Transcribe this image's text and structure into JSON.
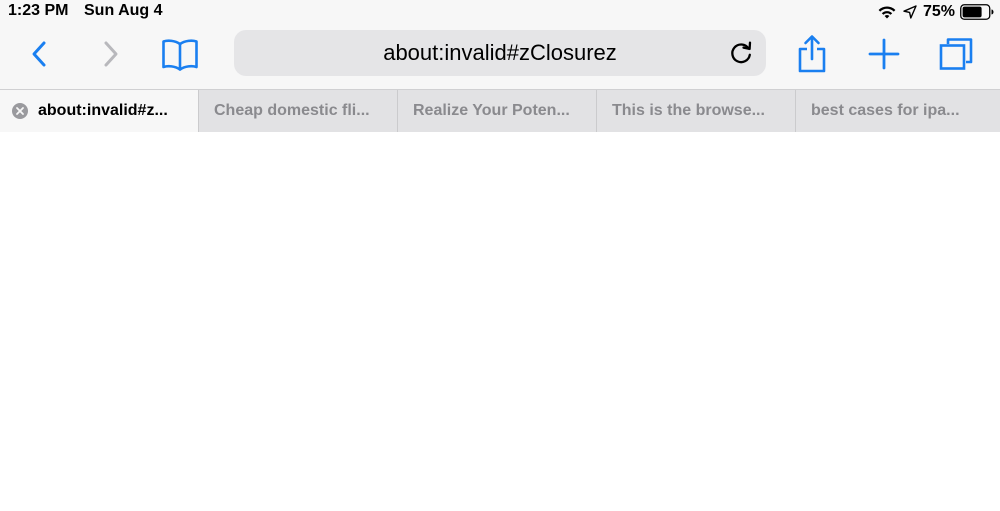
{
  "status_bar": {
    "time": "1:23 PM",
    "date": "Sun Aug 4",
    "battery_percent": "75%",
    "battery_level": 0.75,
    "icons": [
      "wifi-icon",
      "location-arrow-icon",
      "battery-icon"
    ]
  },
  "toolbar": {
    "address": "about:invalid#zClosurez",
    "icons": [
      "chevron-left-icon",
      "chevron-right-icon",
      "book-icon",
      "reload-icon",
      "share-icon",
      "plus-icon",
      "tabs-overview-icon"
    ]
  },
  "tabs": [
    {
      "title": "about:invalid#z...",
      "active": true
    },
    {
      "title": "Cheap domestic fli...",
      "active": false
    },
    {
      "title": "Realize Your Poten...",
      "active": false
    },
    {
      "title": "This is the browse...",
      "active": false
    },
    {
      "title": "best cases for ipa...",
      "active": false
    }
  ],
  "colors": {
    "accent": "#1a7ff0",
    "disabled": "#b8b8bc",
    "chrome_bg": "#f7f7f7",
    "tab_bar_bg": "#e2e2e4",
    "address_bg": "#e5e5e7"
  }
}
